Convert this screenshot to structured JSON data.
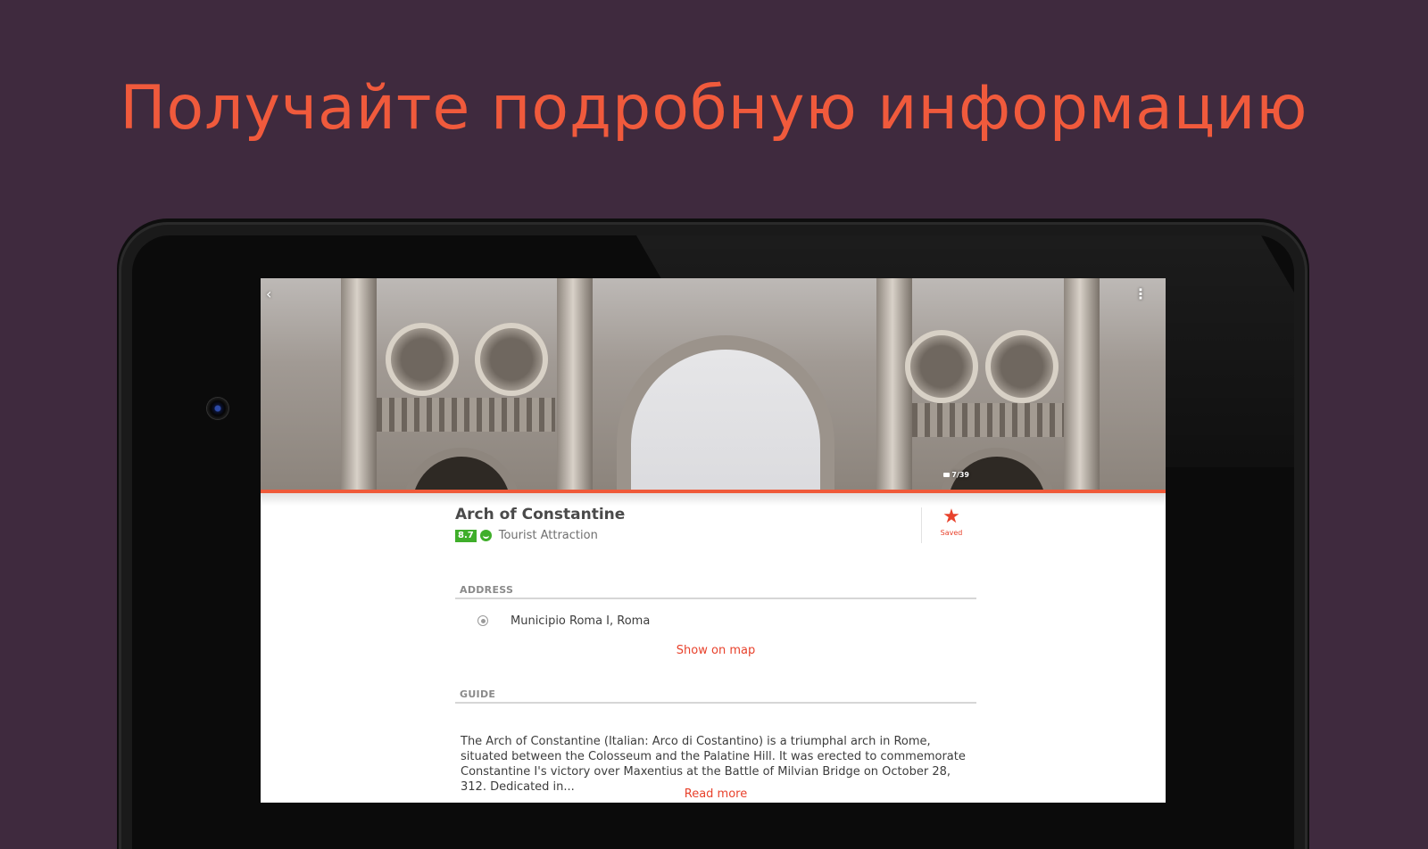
{
  "banner": {
    "headline": "Получайте подробную информацию"
  },
  "app": {
    "hero": {
      "back_icon": "chevron-left-icon",
      "menu_icon": "more-vert-icon",
      "photo_counter": "7/39"
    },
    "place": {
      "name": "Arch of Constantine",
      "rating": "8.7",
      "category": "Tourist Attraction",
      "saved_label": "Saved"
    },
    "address": {
      "header": "ADDRESS",
      "value": "Municipio Roma I, Roma",
      "show_on_map": "Show on map"
    },
    "guide": {
      "header": "GUIDE",
      "text": "The Arch of Constantine (Italian: Arco di Costantino) is a triumphal arch in Rome, situated between the Colosseum and the Palatine Hill. It was erected to commemorate Constantine I's victory over Maxentius at the Battle of Milvian Bridge on October 28, 312. Dedicated in...",
      "read_more": "Read more"
    },
    "colors": {
      "accent": "#e8422c",
      "rating_green": "#3fae2a",
      "background": "#3f2a3e",
      "headline": "#f05a3c"
    }
  }
}
